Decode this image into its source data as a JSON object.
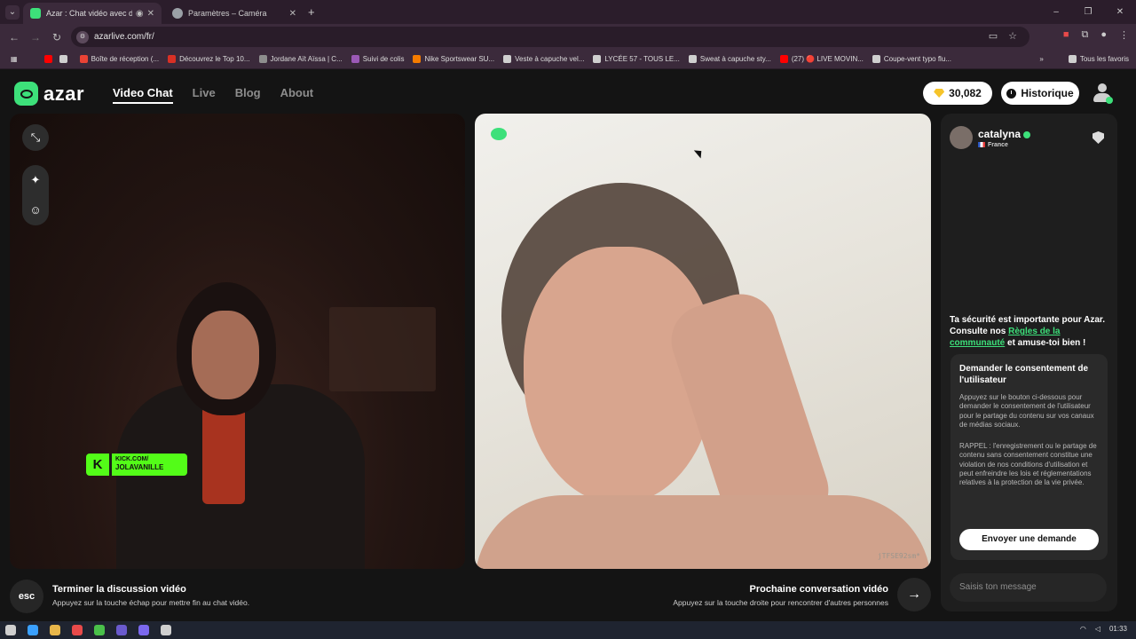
{
  "browser": {
    "tabs": [
      {
        "title": "Azar : Chat vidéo avec de n",
        "active": true,
        "color": "#3de07a"
      },
      {
        "title": "Paramètres – Caméra",
        "active": false,
        "color": "#9aa0a6"
      }
    ],
    "new_tab": "+",
    "window_controls": [
      "–",
      "❐",
      "✕"
    ],
    "url": "azarlive.com/fr/",
    "bookmarks": [
      {
        "label": "Boîte de réception (...",
        "color": "#ea4335"
      },
      {
        "label": "Découvrez le Top 10...",
        "color": "#d93025"
      },
      {
        "label": "Jordane Aït Aïssa | C...",
        "color": "#8e8e8e"
      },
      {
        "label": "Suivi de colis",
        "color": "#9b59b6"
      },
      {
        "label": "Nike Sportswear SU...",
        "color": "#f57c00"
      },
      {
        "label": "Veste à capuche vel...",
        "color": "#cfcfcf"
      },
      {
        "label": "LYCÉE 57 - TOUS LE...",
        "color": "#cfcfcf"
      },
      {
        "label": "Sweat à capuche sty...",
        "color": "#cfcfcf"
      },
      {
        "label": "(27) 🔴 LIVE MOVIN...",
        "color": "#ff0000"
      },
      {
        "label": "Coupe-vent typo flu...",
        "color": "#cfcfcf"
      }
    ],
    "all_bookmarks": "Tous les favoris"
  },
  "app": {
    "logo_text": "azar",
    "nav": [
      {
        "label": "Video Chat",
        "active": true
      },
      {
        "label": "Live",
        "active": false
      },
      {
        "label": "Blog",
        "active": false
      },
      {
        "label": "About",
        "active": false
      }
    ],
    "gems": "30,082",
    "history_label": "Historique"
  },
  "left_video": {
    "kick_line1": "KICK.COM/",
    "kick_line2": "JOLAVANILLE"
  },
  "right_video": {
    "code": "jTFSE92sm*"
  },
  "bottom": {
    "esc_label": "esc",
    "end_title": "Terminer la discussion vidéo",
    "end_sub": "Appuyez sur la touche échap pour mettre fin au chat vidéo.",
    "next_title": "Prochaine conversation vidéo",
    "next_sub": "Appuyez sur la touche droite pour rencontrer d'autres personnes",
    "next_arrow": "→"
  },
  "panel": {
    "name": "catalyna",
    "country": "France",
    "safety_before": "Ta sécurité est importante pour Azar. Consulte nos ",
    "safety_link": "Règles de la communauté",
    "safety_after": " et amuse-toi bien !",
    "consent_title": "Demander le consentement de l'utilisateur",
    "consent_body": "Appuyez sur le bouton ci-dessous pour demander le consentement de l'utilisateur pour le partage du contenu sur vos canaux de médias sociaux.",
    "consent_note": "RAPPEL : l'enregistrement ou le partage de contenu sans consentement constitue une violation de nos conditions d'utilisation et peut enfreindre les lois et réglementations relatives à la protection de la vie privée.",
    "consent_button": "Envoyer une demande",
    "message_placeholder": "Saisis ton message"
  },
  "taskbar": {
    "time": "01:33",
    "icon_colors": [
      "#cfcfcf",
      "#3aa0ff",
      "#e8b64a",
      "#e84a4a",
      "#4ac04a",
      "#6a5acd",
      "#7b68ee",
      "#cfcfcf"
    ]
  }
}
